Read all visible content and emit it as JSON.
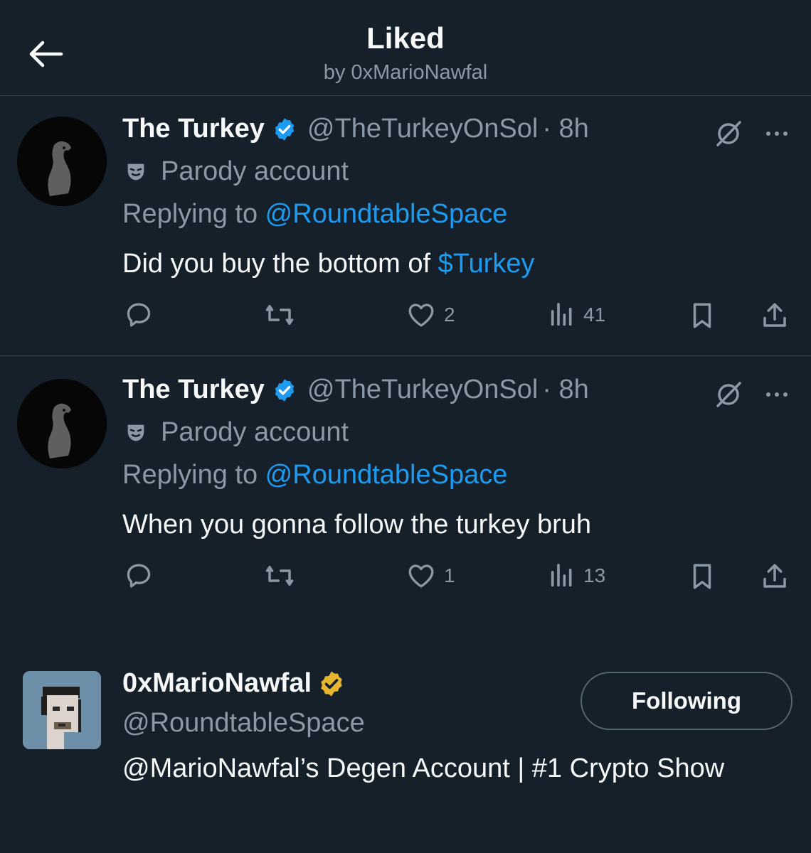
{
  "header": {
    "title": "Liked",
    "subtitle": "by 0xMarioNawfal"
  },
  "tweets": [
    {
      "name": "The Turkey",
      "handle": "@TheTurkeyOnSol",
      "time": "· 8h",
      "parody_label": "Parody account",
      "replying_prefix": "Replying to ",
      "replying_handle": "@RoundtableSpace",
      "text": "Did you buy the bottom of ",
      "text_link": "$Turkey",
      "likes": "2",
      "views": "41"
    },
    {
      "name": "The Turkey",
      "handle": "@TheTurkeyOnSol",
      "time": "· 8h",
      "parody_label": "Parody account",
      "replying_prefix": "Replying to ",
      "replying_handle": "@RoundtableSpace",
      "text": "When you gonna follow the turkey bruh",
      "text_link": "",
      "likes": "1",
      "views": "13"
    }
  ],
  "profile": {
    "name": "0xMarioNawfal",
    "handle": "@RoundtableSpace",
    "bio": "@MarioNawfal’s Degen Account | #1 Crypto Show",
    "follow_label": "Following"
  },
  "colors": {
    "background": "#15202b",
    "accent": "#1d9bf0",
    "muted": "#8b98a5",
    "gold_badge": "#e8b52f"
  }
}
